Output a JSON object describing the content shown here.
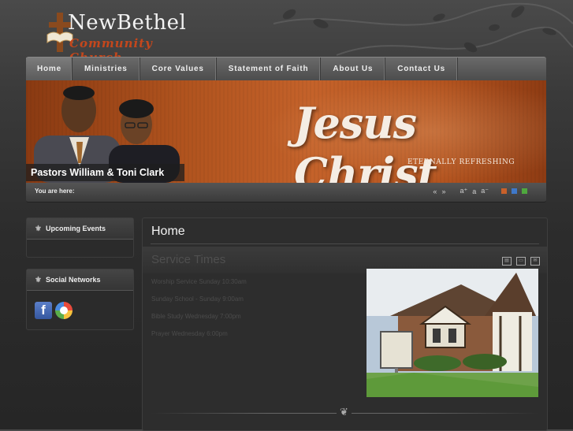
{
  "site": {
    "name": "NewBethel",
    "subtitle": "Community Church"
  },
  "nav": {
    "items": [
      "Home",
      "Ministries",
      "Core Values",
      "Statement of Faith",
      "About Us",
      "Contact Us"
    ],
    "active": "Home"
  },
  "banner": {
    "headline": "Jesus Christ",
    "tagline": "ETERNALLY REFRESHING",
    "caption": "Pastors William & Toni Clark"
  },
  "breadcrumb": {
    "label": "You are here:"
  },
  "font_tools": {
    "prev": "«",
    "next": "»",
    "larger": "a⁺",
    "reset": "a",
    "smaller": "a⁻"
  },
  "style_swatches": [
    "#c8602a",
    "#3f78c8",
    "#4fa83e"
  ],
  "sidebar": {
    "upcoming_events": {
      "title": "Upcoming Events"
    },
    "social_networks": {
      "title": "Social Networks",
      "icons": [
        "facebook-icon",
        "picasa-icon"
      ]
    }
  },
  "main": {
    "title": "Home",
    "section_title": "Service Times",
    "lines": [
      "Worship Service Sunday 10:30am",
      "Sunday School - Sunday 9:00am",
      "Bible Study Wednesday 7:00pm",
      "Prayer  Wednesday 6:00pm"
    ],
    "icons": [
      "pdf-icon",
      "print-icon",
      "email-icon"
    ]
  }
}
